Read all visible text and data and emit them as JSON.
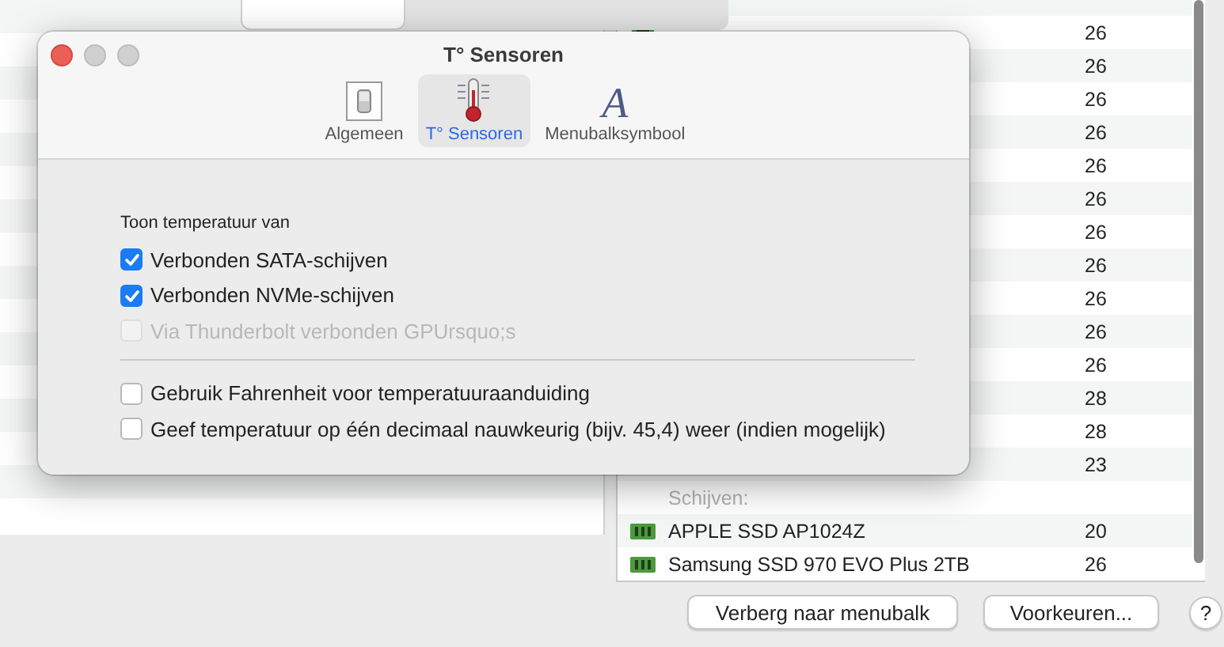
{
  "sensors": {
    "rows": [
      {
        "kind": "chip",
        "value": "26"
      },
      {
        "kind": "hidden",
        "value": "26"
      },
      {
        "kind": "hidden",
        "value": "26"
      },
      {
        "kind": "hidden",
        "value": "26"
      },
      {
        "kind": "hidden",
        "value": "26"
      },
      {
        "kind": "hidden",
        "value": "26"
      },
      {
        "kind": "hidden",
        "value": "26"
      },
      {
        "kind": "hidden",
        "value": "26"
      },
      {
        "kind": "hidden",
        "value": "26"
      },
      {
        "kind": "hidden",
        "value": "26"
      },
      {
        "kind": "hidden",
        "value": "26"
      },
      {
        "kind": "hidden",
        "value": "28"
      },
      {
        "kind": "hidden",
        "value": "28"
      },
      {
        "kind": "hidden",
        "value": "23"
      },
      {
        "kind": "header",
        "name": "Schijven:"
      },
      {
        "kind": "disk",
        "name": "APPLE SSD AP1024Z",
        "value": "20"
      },
      {
        "kind": "disk",
        "name": "Samsung SSD 970 EVO Plus 2TB",
        "value": "26"
      }
    ]
  },
  "buttons": [
    "Verberg naar menubalk",
    "Voorkeuren..."
  ],
  "help": "?",
  "dialog": {
    "title": "T° Sensoren",
    "tabs": [
      {
        "kind": "switch",
        "label": "Algemeen",
        "selected": false
      },
      {
        "kind": "thermometer",
        "label": "T° Sensoren",
        "selected": true
      },
      {
        "kind": "glyph",
        "glyph": "A",
        "label": "Menubalksymbool",
        "selected": false
      }
    ],
    "section_label": "Toon temperatuur van",
    "sources": [
      {
        "label": "Verbonden SATA-schijven",
        "checked": true,
        "disabled": false
      },
      {
        "label": "Verbonden NVMe-schijven",
        "checked": true,
        "disabled": false
      },
      {
        "label": "Via Thunderbolt verbonden GPUrsquo;s",
        "checked": false,
        "disabled": true
      }
    ],
    "options": [
      {
        "label": "Gebruik Fahrenheit voor temperatuuraanduiding",
        "checked": false,
        "disabled": false
      },
      {
        "label": "Geef temperatuur op één decimaal nauwkeurig (bijv. 45,4) weer (indien mogelijk)",
        "checked": false,
        "disabled": false
      }
    ]
  }
}
